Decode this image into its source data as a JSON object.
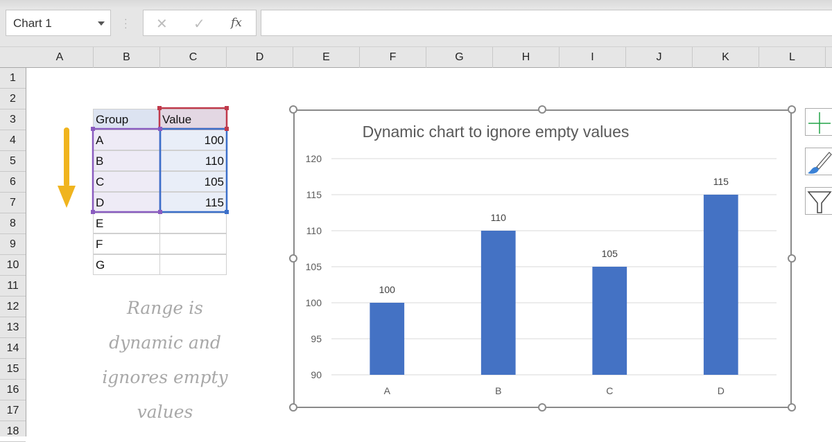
{
  "formula_bar": {
    "name_box": "Chart 1",
    "cancel_icon": "✕",
    "enter_icon": "✓",
    "fx_label": "fx",
    "formula": ""
  },
  "columns": [
    "A",
    "B",
    "C",
    "D",
    "E",
    "F",
    "G",
    "H",
    "I",
    "J",
    "K",
    "L"
  ],
  "rows": [
    "1",
    "2",
    "3",
    "4",
    "5",
    "6",
    "7",
    "8",
    "9",
    "10",
    "11",
    "12",
    "13",
    "14",
    "15",
    "16",
    "17",
    "18"
  ],
  "table": {
    "headers": [
      "Group",
      "Value"
    ],
    "rows": [
      [
        "A",
        "100"
      ],
      [
        "B",
        "110"
      ],
      [
        "C",
        "105"
      ],
      [
        "D",
        "115"
      ],
      [
        "E",
        ""
      ],
      [
        "F",
        ""
      ],
      [
        "G",
        ""
      ]
    ]
  },
  "note_lines": [
    "Range is",
    "dynamic and",
    "ignores empty",
    "values"
  ],
  "colors": {
    "bar": "#4472c4",
    "arrow": "#f0b41e",
    "range_purple": "#8a5cc0",
    "range_red": "#c0394b",
    "range_blue": "#3b6fc9",
    "add_element": "#21a346"
  },
  "chart_tools": [
    "chart-elements",
    "chart-styles",
    "chart-filters"
  ],
  "chart_data": {
    "type": "bar",
    "title": "Dynamic chart to ignore empty values",
    "categories": [
      "A",
      "B",
      "C",
      "D"
    ],
    "values": [
      100,
      110,
      105,
      115
    ],
    "data_labels": [
      "100",
      "110",
      "105",
      "115"
    ],
    "ylim": [
      90,
      120
    ],
    "yticks": [
      90,
      95,
      100,
      105,
      110,
      115,
      120
    ],
    "ytick_labels": [
      "90",
      "95",
      "100",
      "105",
      "110",
      "115",
      "120"
    ],
    "xlabel": "",
    "ylabel": "",
    "grid": true,
    "legend": "none"
  }
}
